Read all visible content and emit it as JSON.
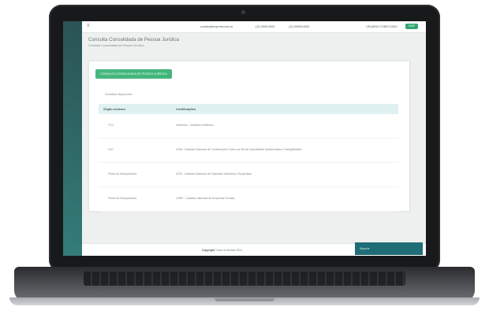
{
  "topbar": {
    "email": "contato@empresa.com.br",
    "phone1": "(11) 0000-0000",
    "phone2": "(11) 00000-0000",
    "user": "USUÁRIO CONECTADO",
    "exit_label": "SAIR"
  },
  "page": {
    "title": "Consulta Consolidada de Pessoa Jurídica",
    "subtitle": "Consulta Consolidada de Pessoa Jurídica"
  },
  "card": {
    "action_label": "CONSULTA CONSOLIDADA DE PESSOA JURÍDICA",
    "status": "Certidões disponíveis",
    "table": {
      "headers": [
        "Órgão emissor",
        "Certificações"
      ],
      "rows": [
        {
          "org": "TCU",
          "cert": "Inidôneos - Licitantes Inidôneos"
        },
        {
          "org": "CNJ",
          "cert": "CNIA - Cadastro Nacional de Condenações Cíveis por Ato de Improbidade Administrativa e Inelegibilidade"
        },
        {
          "org": "Portal da Transparência",
          "cert": "CEIS - Cadastro Nacional de Empresas Inidôneas e Suspensas"
        },
        {
          "org": "Portal da Transparência",
          "cert": "CNEP - Cadastro Nacional de Empresas Punidas"
        }
      ]
    }
  },
  "footer": {
    "copyright": "Copyright",
    "rest": "Todos os direitos 2024",
    "button_label": "Suporte"
  }
}
